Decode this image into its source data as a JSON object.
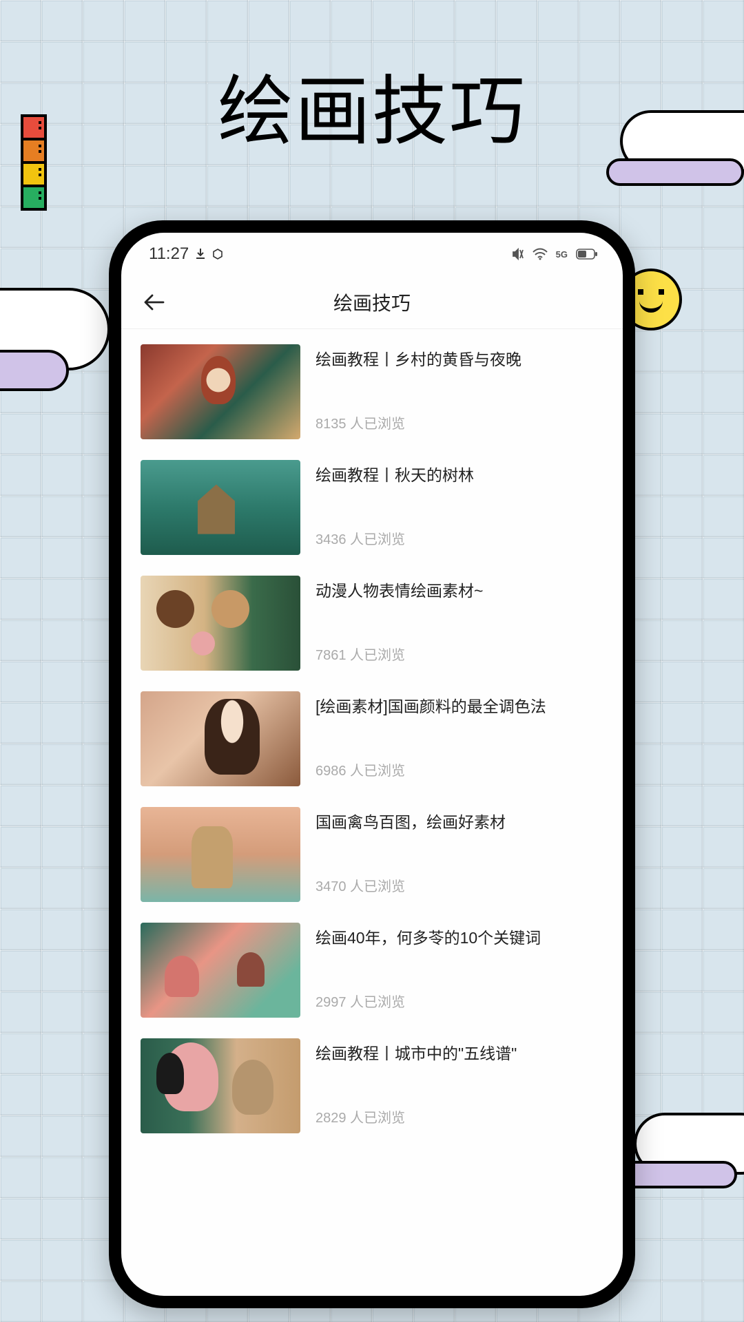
{
  "page": {
    "title": "绘画技巧"
  },
  "status": {
    "time": "11:27",
    "indicators": "↓ ⬡",
    "right": "🔕  📶  5G  🔋"
  },
  "nav": {
    "title": "绘画技巧"
  },
  "views_suffix": "人已浏览",
  "items": [
    {
      "title": "绘画教程丨乡村的黄昏与夜晚",
      "views": "8135"
    },
    {
      "title": "绘画教程丨秋天的树林",
      "views": "3436"
    },
    {
      "title": "动漫人物表情绘画素材~",
      "views": "7861"
    },
    {
      "title": "[绘画素材]国画颜料的最全调色法",
      "views": "6986"
    },
    {
      "title": "国画禽鸟百图，绘画好素材",
      "views": "3470"
    },
    {
      "title": "绘画40年，何多苓的10个关键词",
      "views": "2997"
    },
    {
      "title": "绘画教程丨城市中的\"五线谱\"",
      "views": "2829"
    }
  ]
}
